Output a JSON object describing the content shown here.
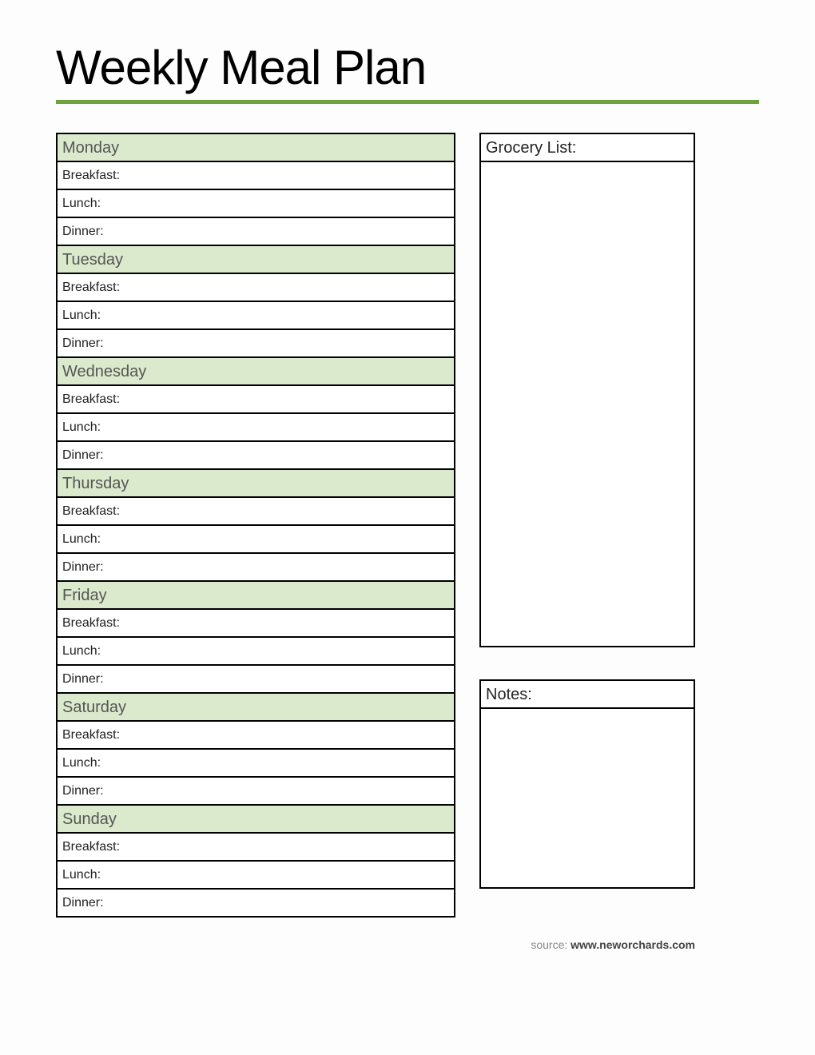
{
  "title": "Weekly Meal Plan",
  "days": [
    {
      "name": "Monday",
      "meals": [
        "Breakfast:",
        "Lunch:",
        "Dinner:"
      ]
    },
    {
      "name": "Tuesday",
      "meals": [
        "Breakfast:",
        "Lunch:",
        "Dinner:"
      ]
    },
    {
      "name": "Wednesday",
      "meals": [
        "Breakfast:",
        "Lunch:",
        "Dinner:"
      ]
    },
    {
      "name": "Thursday",
      "meals": [
        "Breakfast:",
        "Lunch:",
        "Dinner:"
      ]
    },
    {
      "name": "Friday",
      "meals": [
        "Breakfast:",
        "Lunch:",
        "Dinner:"
      ]
    },
    {
      "name": "Saturday",
      "meals": [
        "Breakfast:",
        "Lunch:",
        "Dinner:"
      ]
    },
    {
      "name": "Sunday",
      "meals": [
        "Breakfast:",
        "Lunch:",
        "Dinner:"
      ]
    }
  ],
  "sidebar": {
    "grocery_label": "Grocery List:",
    "notes_label": "Notes:"
  },
  "source": {
    "prefix": "source: ",
    "url": "www.neworchards.com"
  },
  "colors": {
    "accent": "#6da23f",
    "day_bg": "#dbe9cc"
  }
}
